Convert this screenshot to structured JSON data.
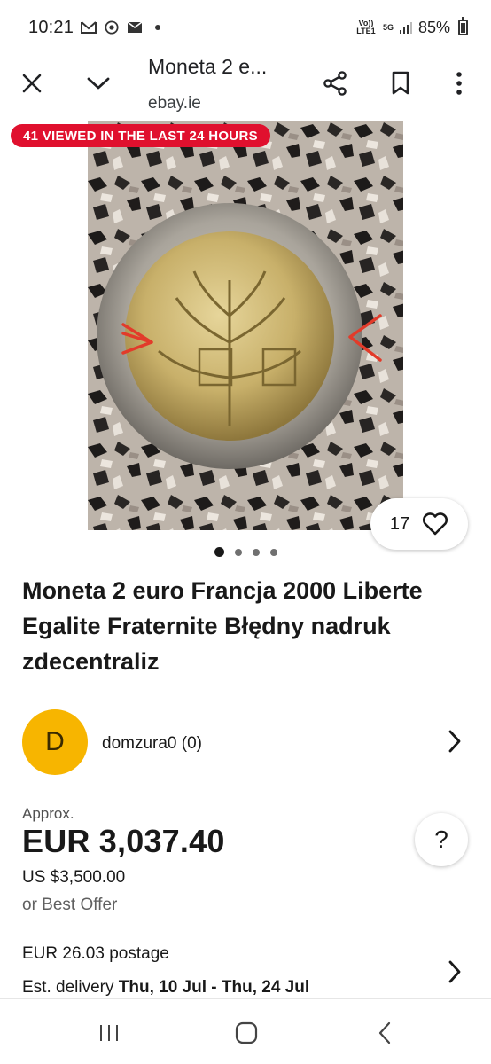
{
  "status_bar": {
    "time": "10:21",
    "battery": "85%",
    "network": "5G",
    "volte": "Vo)) LTE1"
  },
  "browser": {
    "title": "Moneta 2 e...",
    "domain": "ebay.ie",
    "icons": [
      "close-icon",
      "chevron-down-icon",
      "share-icon",
      "bookmark-icon",
      "more-vert-icon"
    ]
  },
  "gallery": {
    "viewed_badge": "41 VIEWED IN THE LAST 24 HOURS",
    "watch_count": "17",
    "image_count": 4,
    "active_index": 0
  },
  "item": {
    "title": "Moneta 2 euro Francja 2000 Liberte Egalite Fraternite Błędny nadruk zdecentraliz"
  },
  "seller": {
    "initial": "D",
    "name": "domzura0 (0)",
    "avatar_color": "#f7b500"
  },
  "pricing": {
    "approx_label": "Approx.",
    "price": "EUR 3,037.40",
    "usd_price": "US $3,500.00",
    "best_offer": "or Best Offer",
    "help": "?"
  },
  "shipping": {
    "postage": "EUR 26.03 postage",
    "delivery_label": "Est. delivery ",
    "delivery_dates": "Thu, 10 Jul - Thu, 24 Jul"
  },
  "colors": {
    "badge": "#e0102e",
    "text": "#191919"
  }
}
